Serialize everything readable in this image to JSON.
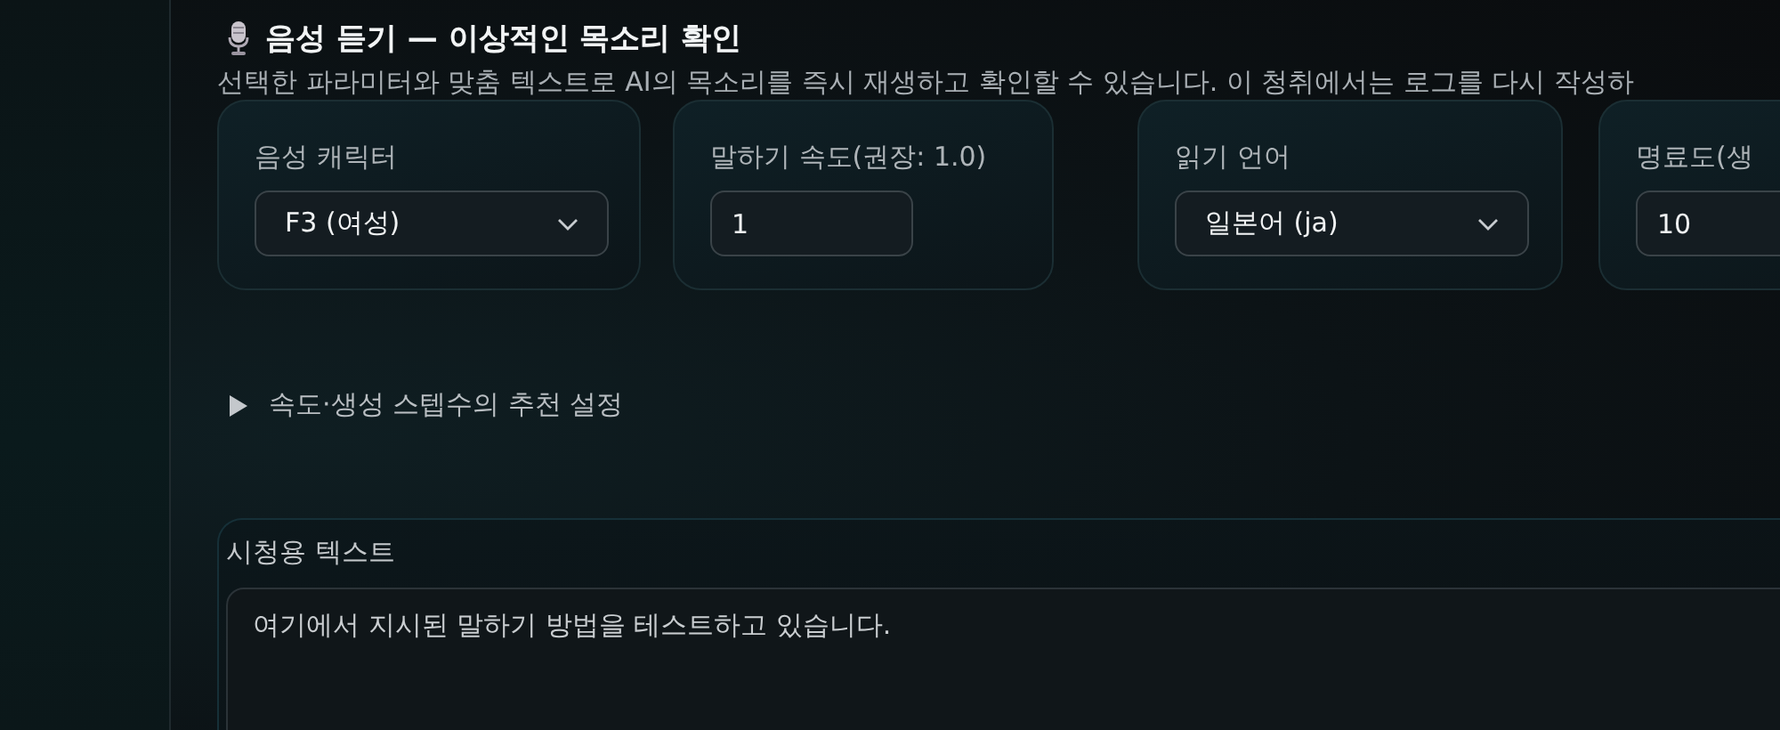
{
  "header": {
    "title": "음성 듣기 — 이상적인 목소리 확인",
    "description": "선택한 파라미터와 맞춤 텍스트로 AI의 목소리를 즉시 재생하고 확인할 수 있습니다. 이 청취에서는 로그를 다시 작성하"
  },
  "settings": [
    {
      "kind": "select",
      "label": "음성 캐릭터",
      "value": "F3 (여성)"
    },
    {
      "kind": "number",
      "label": "말하기 속도(권장: 1.0)",
      "value": "1"
    },
    {
      "kind": "select",
      "label": "읽기 언어",
      "value": "일본어 (ja)"
    },
    {
      "kind": "number",
      "label": "명료도(생",
      "value": "10"
    }
  ],
  "disclosure": {
    "label": "속도·생성 스텝수의 추천 설정",
    "expanded": false
  },
  "preview_text": {
    "label": "시청용 텍스트",
    "value": "여기에서 지시된 말하기 방법을 테스트하고 있습니다."
  }
}
